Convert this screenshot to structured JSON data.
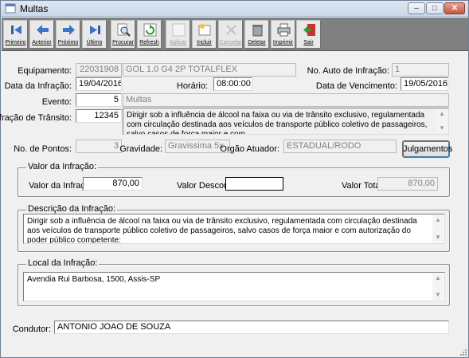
{
  "window": {
    "title": "Multas"
  },
  "toolbar": {
    "buttons": [
      {
        "label": "Primeiro",
        "icon": "first-record-icon",
        "enabled": true
      },
      {
        "label": "Anterior",
        "icon": "previous-record-icon",
        "enabled": true
      },
      {
        "label": "Próximo",
        "icon": "next-record-icon",
        "enabled": true
      },
      {
        "label": "Último",
        "icon": "last-record-icon",
        "enabled": true
      },
      {
        "label": "Procurar",
        "icon": "search-icon",
        "enabled": true
      },
      {
        "label": "Refresh",
        "icon": "refresh-icon",
        "enabled": true
      },
      {
        "label": "Aplicar",
        "icon": "apply-icon",
        "enabled": false
      },
      {
        "label": "Incluir",
        "icon": "insert-icon",
        "enabled": true
      },
      {
        "label": "Cancelar",
        "icon": "cancel-icon",
        "enabled": false
      },
      {
        "label": "Deletar",
        "icon": "delete-icon",
        "enabled": true
      },
      {
        "label": "Imprimir",
        "icon": "print-icon",
        "enabled": true
      },
      {
        "label": "Sair",
        "icon": "exit-icon",
        "enabled": true
      }
    ]
  },
  "form": {
    "equipamento": {
      "label": "Equipamento:",
      "code": "22031908",
      "description": "GOL 1.0 G4 2P TOTALFLEX"
    },
    "auto_infracao": {
      "label": "No. Auto de Infração:",
      "value": "1"
    },
    "data_infracao": {
      "label": "Data da Infração:",
      "value": "19/04/2016"
    },
    "horario": {
      "label": "Horário:",
      "value": "08:00:00"
    },
    "data_vencimento": {
      "label": "Data de Vencimento:",
      "value": "19/05/2016"
    },
    "evento": {
      "label": "Evento:",
      "code": "5",
      "description": "Multas"
    },
    "infracao_transito": {
      "label": "Infração de Trânsito:",
      "code": "12345",
      "description": "Dirigir sob a influência de álcool na faixa ou via de trânsito exclusivo, regulamentada com circulação destinada aos veículos de transporte público coletivo de passageiros, salvo casos de força maior e com"
    },
    "pontos": {
      "label": "No. de Pontos:",
      "value": "3"
    },
    "gravidade": {
      "label": "Gravidade:",
      "value": "Gravissima 5x"
    },
    "orgao": {
      "label": "Orgão Atuador:",
      "value": "ESTADUAL/RODO"
    },
    "julgamentos_button": "Julgamentos",
    "valor_group": {
      "title": "Valor da Infração:",
      "valor_label": "Valor da Infração:",
      "valor": "870,00",
      "desconto_label": "Valor Desconto:",
      "desconto": "",
      "total_label": "Valor Total:",
      "total": "870,00"
    },
    "descricao_group": {
      "title": "Descrição da Infração:",
      "text": "Dirigir sob a influência de álcool na faixa ou via de trânsito exclusivo, regulamentada com circulação destinada aos veículos de transporte público coletivo de passageiros, salvo casos de força maior e com autorização do poder público competente:"
    },
    "local_group": {
      "title": "Local da Infração:",
      "text": "Avendia Rui Barbosa, 1500, Assis-SP"
    },
    "condutor": {
      "label": "Condutor:",
      "value": "ANTONIO JOAO DE SOUZA"
    }
  }
}
